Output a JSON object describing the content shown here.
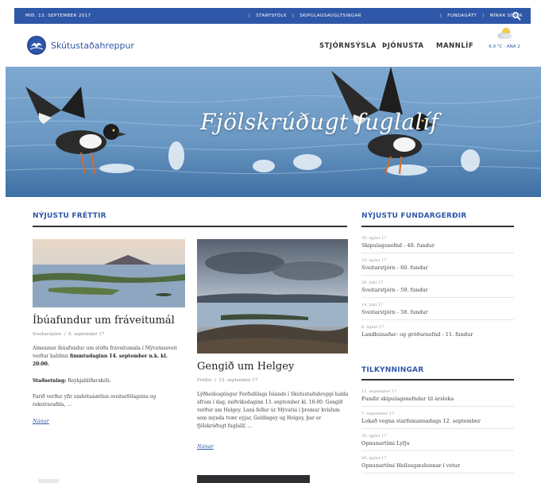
{
  "topbar": {
    "date": "MIÐ. 13. SEPTEMBER 2017",
    "links_left": [
      "STARFSFÓLK",
      "SKIPULAGSAUGLÝSINGAR"
    ],
    "links_right": [
      "FUNDAGÁTT",
      "MÍNAR SÍÐUR"
    ]
  },
  "header": {
    "site_name": "Skútustaðahreppur",
    "nav": [
      "STJÓRNSÝSLA",
      "ÞJÓNUSTA",
      "MANNLÍF"
    ],
    "weather": "6,9 °C - ANA 2"
  },
  "hero": {
    "title": "Fjölskrúðugt fuglalíf"
  },
  "news": {
    "heading": "NÝJUSTU FRÉTTIR",
    "articles": [
      {
        "title": "Íbúafundur um fráveitumál",
        "author": "Sveitarstjórn",
        "date": "6. september 17",
        "body_1": "Almennur íbúafundur um stöðu fráveitumála í Mývatnssveit verður haldinn ",
        "body_1_bold": "fimmtudaginn 14. september n.k. kl. 20:00.",
        "body_2_bold": "Staðsetning:",
        "body_2": " Reykjahlíðarskóli.",
        "body_3": "Farið verður yfir umhótaáætlun sveitarfélagsins og rekstraraðila, ...",
        "more": "Nánar"
      },
      {
        "title": "Gengið um Helgey",
        "author": "Fréttir",
        "date": "13. september 17",
        "body": "Lýðheilsugöngur Ferðafélags Íslands í Skútustaðahreppi halda áfram í dag, miðvikudaginn 13. september kl. 18:00. Gengið verður um Helgey. Laxá fellur úr Mývatni í þremur kvíslum sem mynda tvær eyjar, Geldingey og Helgey, þar er fjölskrúðugt fuglalíf, ...",
        "more": "Nánar"
      }
    ]
  },
  "meetings": {
    "heading": "NÝJUSTU FUNDARGERÐIR",
    "items": [
      {
        "date": "30. ágúst 17",
        "title": "Skipulagsnefnd - 40. fundur"
      },
      {
        "date": "23. ágúst 17",
        "title": "Sveitarstjórn - 60. fundur"
      },
      {
        "date": "28. júní 17",
        "title": "Sveitarstjórn - 59. fundur"
      },
      {
        "date": "14. júní 17",
        "title": "Sveitarstjórn - 58. fundur"
      },
      {
        "date": "8. ágúst 17",
        "title": "Landbúnaðar- og gróðurnefnd - 11. fundur"
      }
    ]
  },
  "notices": {
    "heading": "TILKYNNINGAR",
    "items": [
      {
        "date": "11. september 17",
        "title": "Fundir skipulagsnefndar til ársloka"
      },
      {
        "date": "7. september 17",
        "title": "Lokað vegna starfsmannadags 12. september"
      },
      {
        "date": "30. ágúst 17",
        "title": "Opnunartími Lyfju"
      },
      {
        "date": "30. ágúst 17",
        "title": "Opnunartími Heilsugæslunnar í vetur"
      }
    ]
  },
  "colors": {
    "brand": "#2f57a8",
    "topbar": "#2f57a8"
  }
}
